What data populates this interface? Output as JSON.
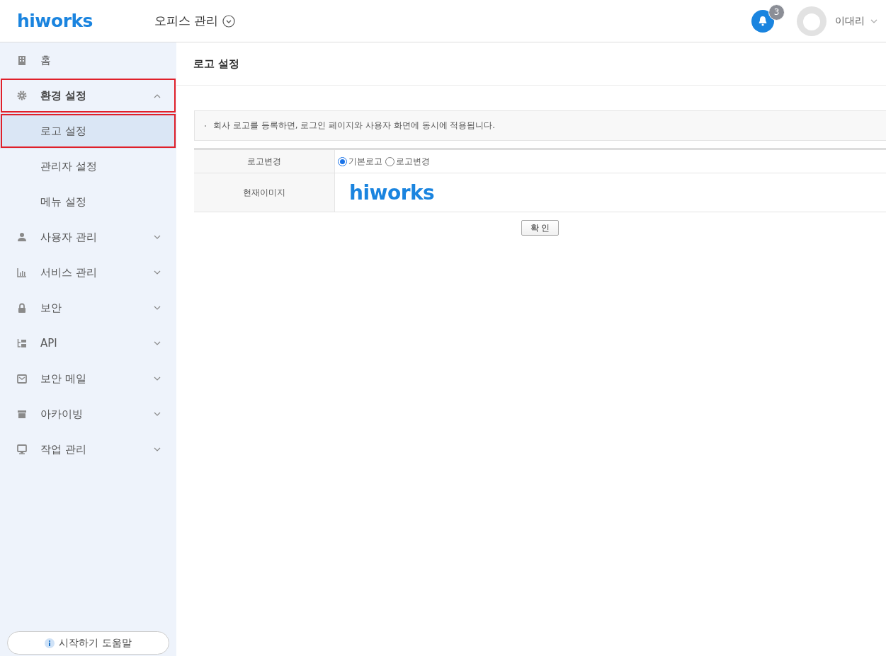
{
  "header": {
    "logo": "hiworks",
    "app_title": "오피스 관리",
    "notification_count": "3",
    "user_name": "이대리"
  },
  "sidebar": {
    "items": [
      {
        "label": "홈",
        "expanded": false,
        "highlighted": false
      },
      {
        "label": "환경 설정",
        "expanded": true,
        "highlighted": true,
        "children": [
          {
            "label": "로고 설정",
            "selected": true,
            "highlighted": true
          },
          {
            "label": "관리자 설정",
            "selected": false,
            "highlighted": false
          },
          {
            "label": "메뉴 설정",
            "selected": false,
            "highlighted": false
          }
        ]
      },
      {
        "label": "사용자 관리",
        "expanded": false,
        "highlighted": false
      },
      {
        "label": "서비스 관리",
        "expanded": false,
        "highlighted": false
      },
      {
        "label": "보안",
        "expanded": false,
        "highlighted": false
      },
      {
        "label": "API",
        "expanded": false,
        "highlighted": false
      },
      {
        "label": "보안 메일",
        "expanded": false,
        "highlighted": false
      },
      {
        "label": "아카이빙",
        "expanded": false,
        "highlighted": false
      },
      {
        "label": "작업 관리",
        "expanded": false,
        "highlighted": false
      }
    ],
    "help_button": "시작하기 도움말"
  },
  "page": {
    "title": "로고 설정",
    "notice": "회사 로고를 등록하면, 로그인 페이지와 사용자 화면에 동시에 적용됩니다.",
    "form": {
      "logo_change_label": "로고변경",
      "options": [
        {
          "label": "기본로고",
          "selected": true
        },
        {
          "label": "로고변경",
          "selected": false
        }
      ],
      "current_image_label": "현재이미지",
      "current_logo": "hiworks"
    },
    "confirm_button": "확 인"
  }
}
